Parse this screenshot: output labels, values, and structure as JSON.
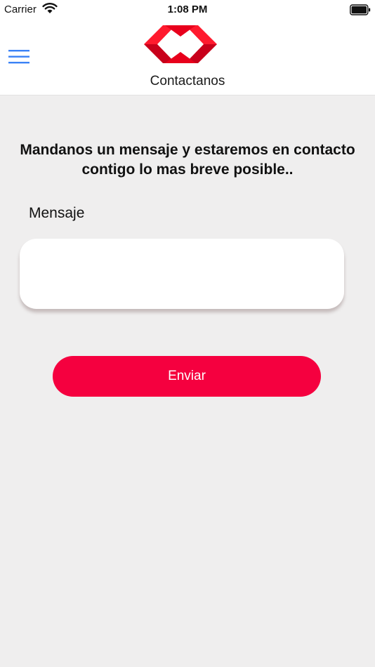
{
  "status_bar": {
    "carrier": "Carrier",
    "time": "1:08 PM",
    "wifi_icon": "wifi-icon",
    "battery_icon": "battery-full-icon"
  },
  "header": {
    "menu_icon": "hamburger-menu-icon",
    "logo_icon": "red-diamond-logo-icon",
    "title": "Contactanos"
  },
  "form": {
    "intro_text": "Mandanos un mensaje y estaremos en contacto contigo lo mas breve posible..",
    "message_label": "Mensaje",
    "message_value": "",
    "message_placeholder": "",
    "send_label": "Enviar"
  },
  "colors": {
    "accent": "#f5003f",
    "menu_icon": "#3b82f6",
    "logo_red": "#e8001c",
    "background": "#efeeee",
    "header_background": "#ffffff"
  }
}
